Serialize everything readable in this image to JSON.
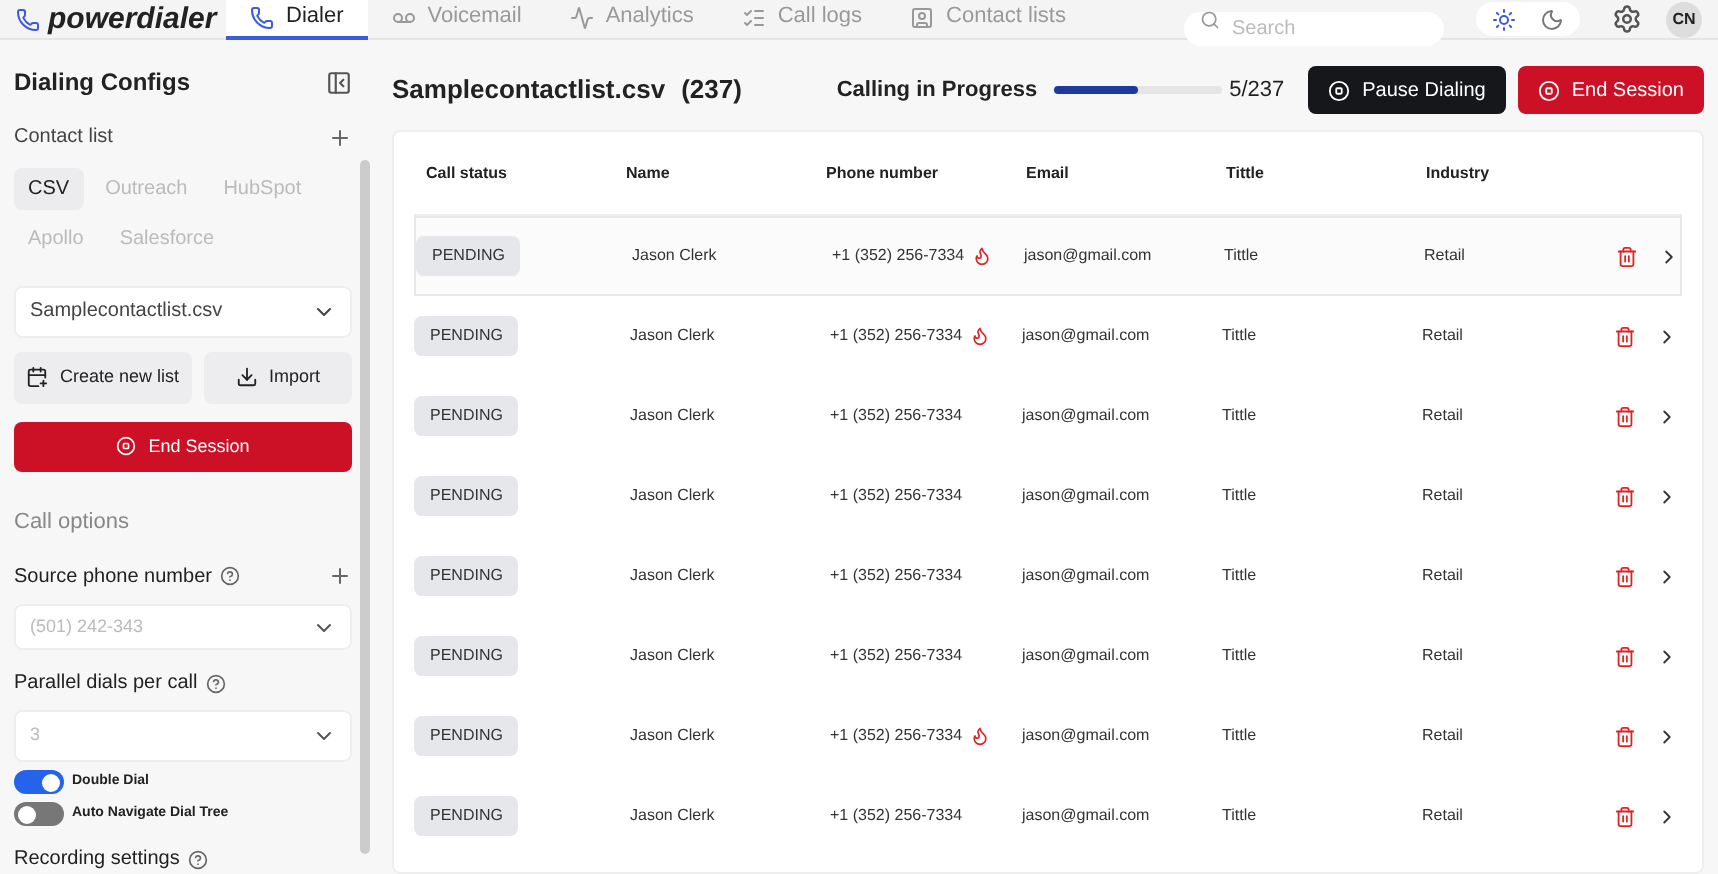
{
  "brand": "powerdialer",
  "nav_tabs": [
    {
      "label": "Dialer",
      "selected": true
    },
    {
      "label": "Voicemail",
      "selected": false
    },
    {
      "label": "Analytics",
      "selected": false
    },
    {
      "label": "Call logs",
      "selected": false
    },
    {
      "label": "Contact lists",
      "selected": false
    }
  ],
  "search": {
    "placeholder": "Search"
  },
  "theme": {
    "light_selected": true
  },
  "avatar": "CN",
  "sidebar": {
    "title": "Dialing Configs",
    "contact_list_label": "Contact list",
    "sources": [
      {
        "label": "CSV",
        "selected": true
      },
      {
        "label": "Outreach",
        "selected": false
      },
      {
        "label": "HubSpot",
        "selected": false
      },
      {
        "label": "Apollo",
        "selected": false
      },
      {
        "label": "Salesforce",
        "selected": false
      }
    ],
    "list_select": "Samplecontactlist.csv",
    "create_button": "Create new list",
    "import_button": "Import",
    "end_button": "End Session",
    "call_options": "Call options",
    "source_phone_label": "Source phone number",
    "source_phone_placeholder": "(501) 242-343",
    "parallel_label": "Parallel dials per call",
    "parallel_placeholder": "3",
    "toggles": [
      {
        "label": "Double Dial",
        "on": true
      },
      {
        "label": "Auto Navigate Dial Tree",
        "on": false
      }
    ],
    "recording_label": "Recording settings"
  },
  "header": {
    "title": "Samplecontactlist.csv",
    "count": "(237)",
    "progress_label": "Calling in Progress",
    "level": 0.5,
    "progress_text": "5/237",
    "pause_button": "Pause Dialing",
    "end_button": "End Session"
  },
  "table": {
    "columns": [
      "Call status",
      "Name",
      "Phone number",
      "Email",
      "Tittle",
      "Industry"
    ],
    "rows": [
      {
        "status": "PENDING",
        "name": "Jason Clerk",
        "phone": "+1 (352) 256-7334",
        "hot": true,
        "email": "jason@gmail.com",
        "title": "Tittle",
        "industry": "Retail",
        "selected": true
      },
      {
        "status": "PENDING",
        "name": "Jason Clerk",
        "phone": "+1 (352) 256-7334",
        "hot": true,
        "email": "jason@gmail.com",
        "title": "Tittle",
        "industry": "Retail",
        "selected": false
      },
      {
        "status": "PENDING",
        "name": "Jason Clerk",
        "phone": "+1 (352) 256-7334",
        "hot": false,
        "email": "jason@gmail.com",
        "title": "Tittle",
        "industry": "Retail",
        "selected": false
      },
      {
        "status": "PENDING",
        "name": "Jason Clerk",
        "phone": "+1 (352) 256-7334",
        "hot": false,
        "email": "jason@gmail.com",
        "title": "Tittle",
        "industry": "Retail",
        "selected": false
      },
      {
        "status": "PENDING",
        "name": "Jason Clerk",
        "phone": "+1 (352) 256-7334",
        "hot": false,
        "email": "jason@gmail.com",
        "title": "Tittle",
        "industry": "Retail",
        "selected": false
      },
      {
        "status": "PENDING",
        "name": "Jason Clerk",
        "phone": "+1 (352) 256-7334",
        "hot": false,
        "email": "jason@gmail.com",
        "title": "Tittle",
        "industry": "Retail",
        "selected": false
      },
      {
        "status": "PENDING",
        "name": "Jason Clerk",
        "phone": "+1 (352) 256-7334",
        "hot": true,
        "email": "jason@gmail.com",
        "title": "Tittle",
        "industry": "Retail",
        "selected": false
      },
      {
        "status": "PENDING",
        "name": "Jason Clerk",
        "phone": "+1 (352) 256-7334",
        "hot": false,
        "email": "jason@gmail.com",
        "title": "Tittle",
        "industry": "Retail",
        "selected": false
      }
    ]
  }
}
